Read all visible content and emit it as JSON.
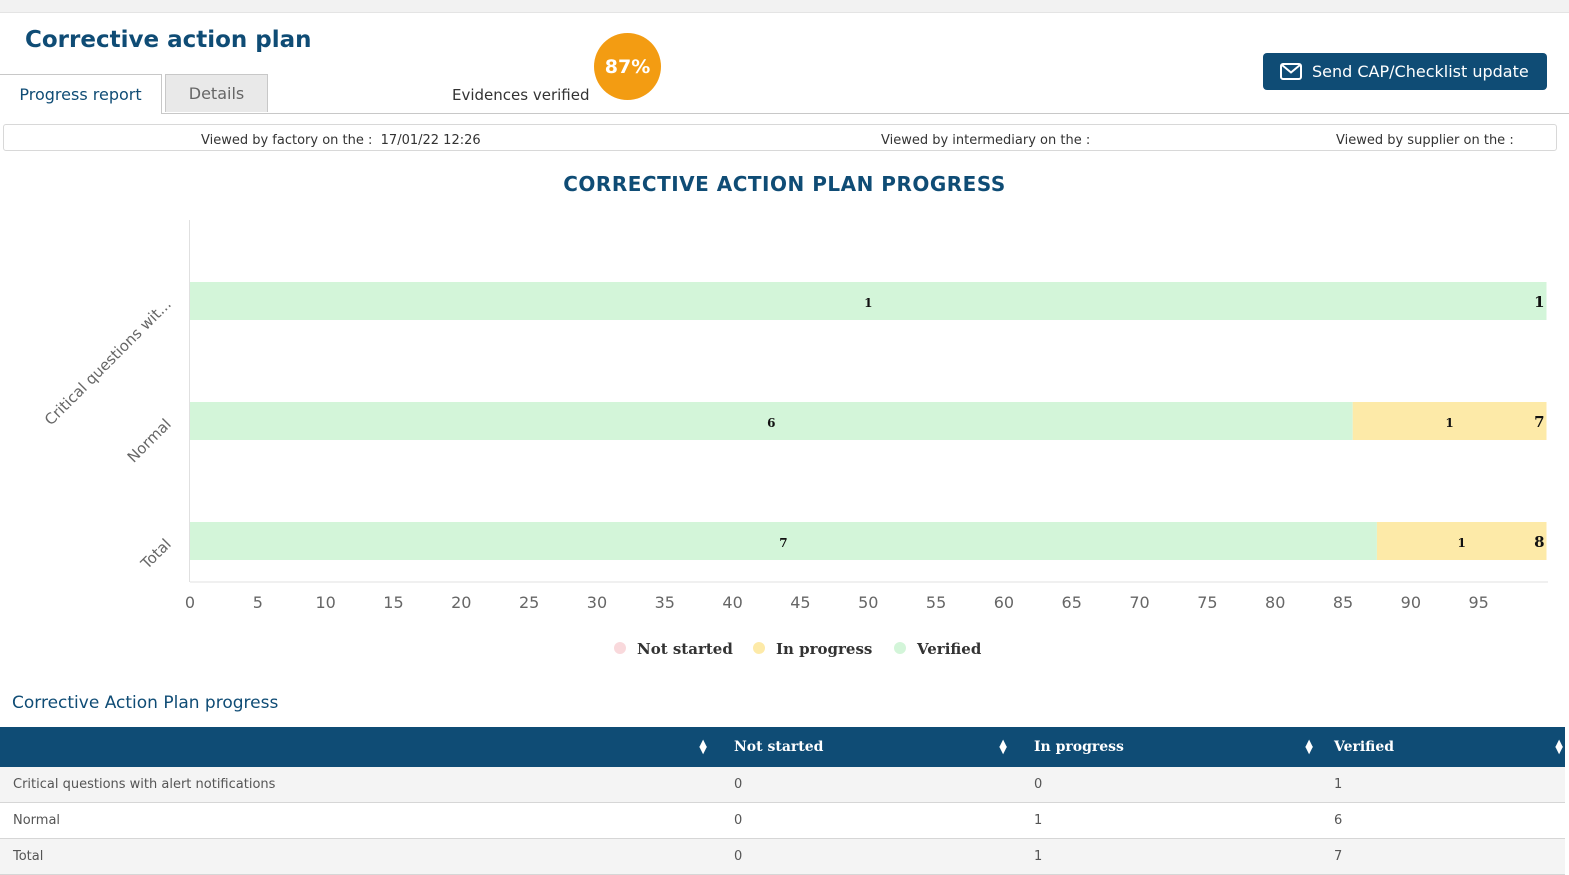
{
  "page": {
    "title": "Corrective action plan",
    "tabs": [
      {
        "label": "Progress report",
        "active": true
      },
      {
        "label": "Details",
        "active": false
      }
    ],
    "evidences": {
      "label": "Evidences verified",
      "percent": "87%",
      "color": "#f39c12"
    },
    "send_button": {
      "label": "Send CAP/Checklist update",
      "icon": "envelope-icon"
    }
  },
  "viewed": {
    "factory": "Viewed by factory on the :  17/01/22 12:26",
    "intermediary": "Viewed by intermediary on the :",
    "supplier": "Viewed by supplier on the :"
  },
  "chart_data": {
    "type": "bar",
    "orientation": "horizontal",
    "stacked": true,
    "title": "CORRECTIVE ACTION PLAN PROGRESS",
    "categories": [
      "Critical questions wit...",
      "Normal",
      "Total"
    ],
    "series": [
      {
        "name": "Not started",
        "values": [
          0,
          0,
          0
        ],
        "color": "#f9d9dc"
      },
      {
        "name": "In progress",
        "values": [
          0,
          1,
          1
        ],
        "color": "#fdeaa8"
      },
      {
        "name": "Verified",
        "values": [
          1,
          6,
          7
        ],
        "color": "#d3f5d9"
      }
    ],
    "totals": [
      1,
      7,
      8
    ],
    "xticks": [
      0,
      5,
      10,
      15,
      20,
      25,
      30,
      35,
      40,
      45,
      50,
      55,
      60,
      65,
      70,
      75,
      80,
      85,
      90,
      95
    ],
    "xlim": [
      0,
      100
    ],
    "scale": "percent",
    "legend_position": "bottom-center"
  },
  "table": {
    "title": "Corrective Action Plan progress",
    "headers": [
      "",
      "Not started",
      "In progress",
      "Verified"
    ],
    "rows": [
      [
        "Critical questions with alert notifications",
        "0",
        "0",
        "1"
      ],
      [
        "Normal",
        "0",
        "1",
        "6"
      ],
      [
        "Total",
        "0",
        "1",
        "7"
      ]
    ],
    "sort_icon": "sort-icon",
    "header_color": "#0f4c75"
  }
}
